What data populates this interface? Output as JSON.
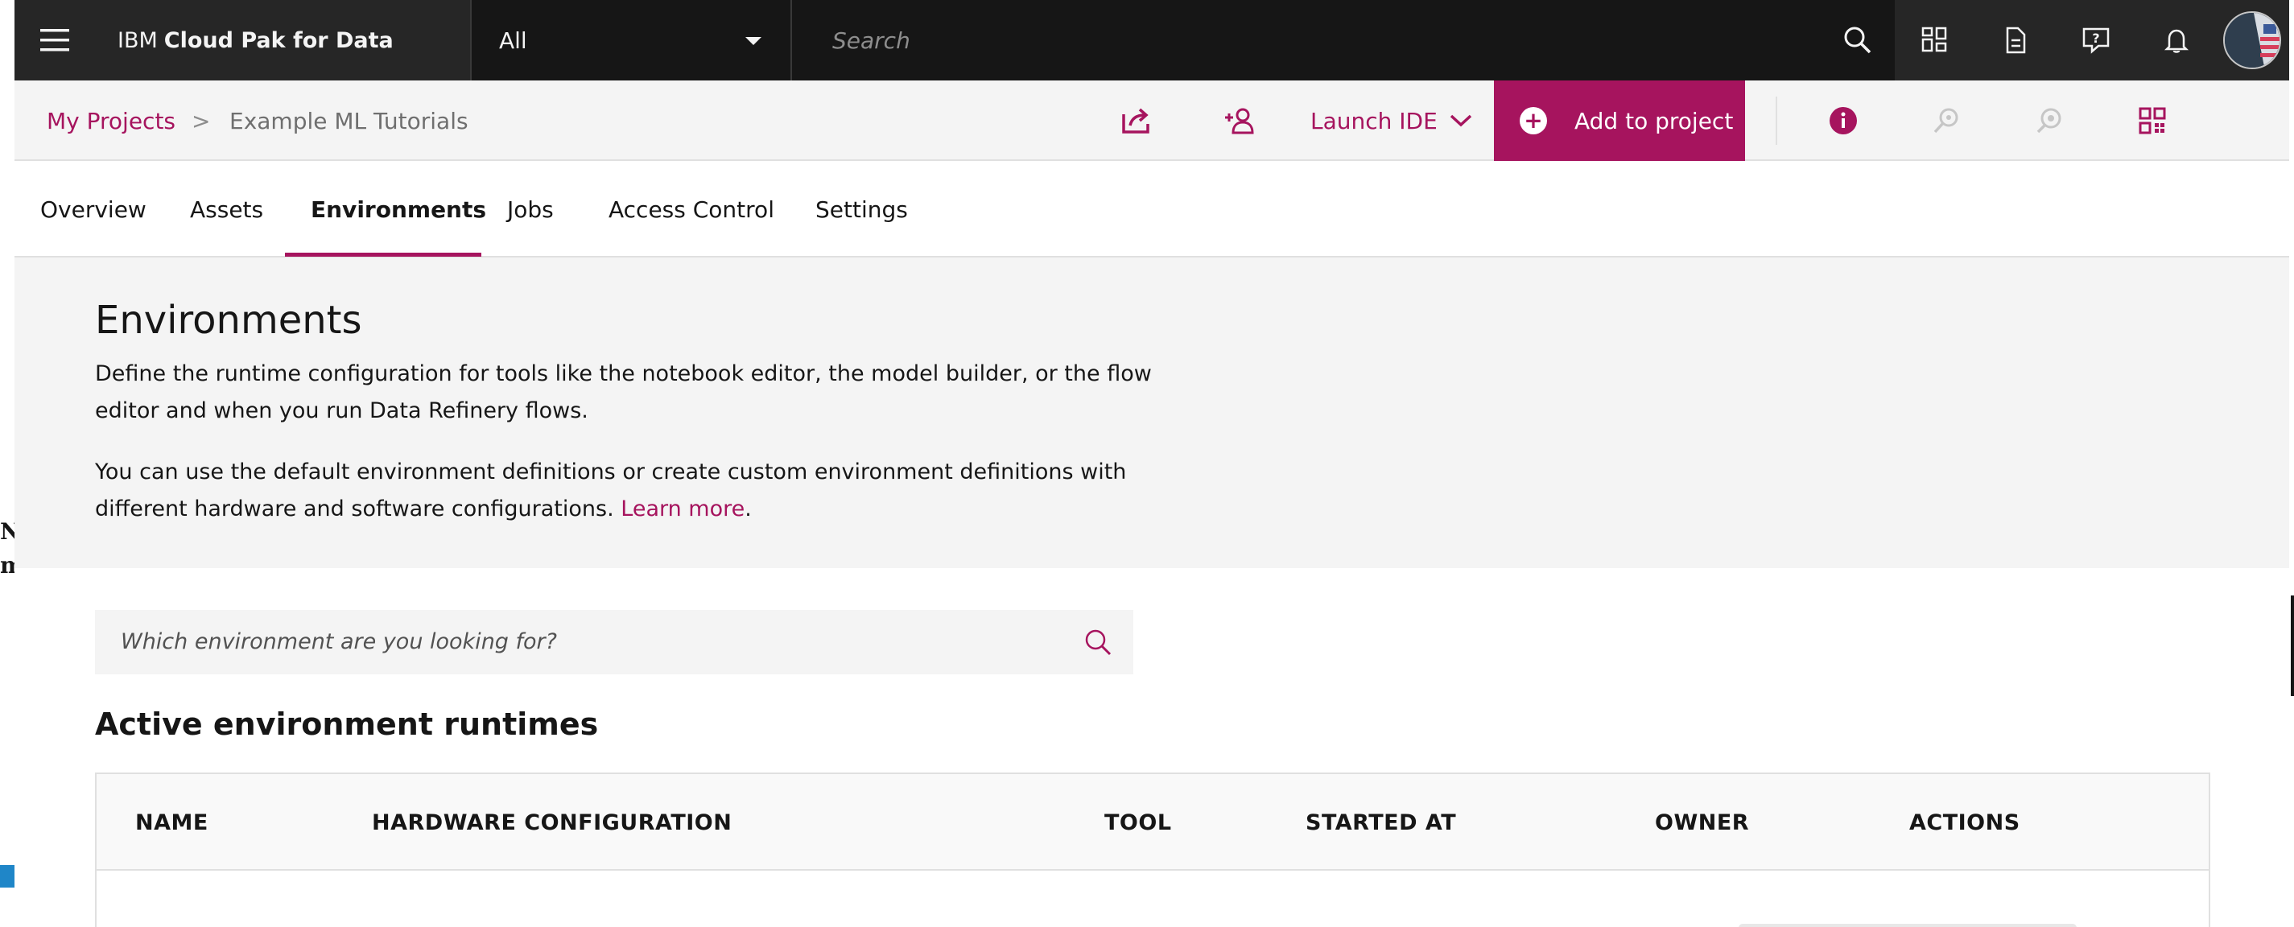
{
  "topbar": {
    "brand_prefix": "IBM",
    "brand_name": "Cloud Pak for Data",
    "scope_value": "All",
    "search_placeholder": "Search",
    "icons": [
      "search-icon",
      "catalog-icon",
      "document-icon",
      "help-icon",
      "notification-icon"
    ]
  },
  "project": {
    "breadcrumb_root": "My Projects",
    "breadcrumb_separator": ">",
    "breadcrumb_current": "Example ML Tutorials",
    "launch_ide_label": "Launch IDE",
    "add_to_project_label": "Add to project",
    "accent_color": "#a6145e"
  },
  "tabs": [
    {
      "label": "Overview",
      "active": false
    },
    {
      "label": "Assets",
      "active": false
    },
    {
      "label": "Environments",
      "active": true
    },
    {
      "label": "Jobs",
      "active": false
    },
    {
      "label": "Access Control",
      "active": false
    },
    {
      "label": "Settings",
      "active": false
    }
  ],
  "hero": {
    "title": "Environments",
    "description_1": "Define the runtime configuration for tools like the notebook editor, the model builder, or the flow editor and when you run Data Refinery flows.",
    "description_2_text": "You can use the default environment definitions or create custom environment definitions with different hardware and software configurations.",
    "learn_more_label": "Learn more",
    "period": "."
  },
  "environment_search": {
    "placeholder": "Which environment are you looking for?"
  },
  "active_runtimes": {
    "title": "Active environment runtimes",
    "columns": [
      "NAME",
      "HARDWARE CONFIGURATION",
      "TOOL",
      "STARTED AT",
      "OWNER",
      "ACTIONS"
    ]
  },
  "edge_glyphs": {
    "n": "N",
    "m": "m"
  }
}
